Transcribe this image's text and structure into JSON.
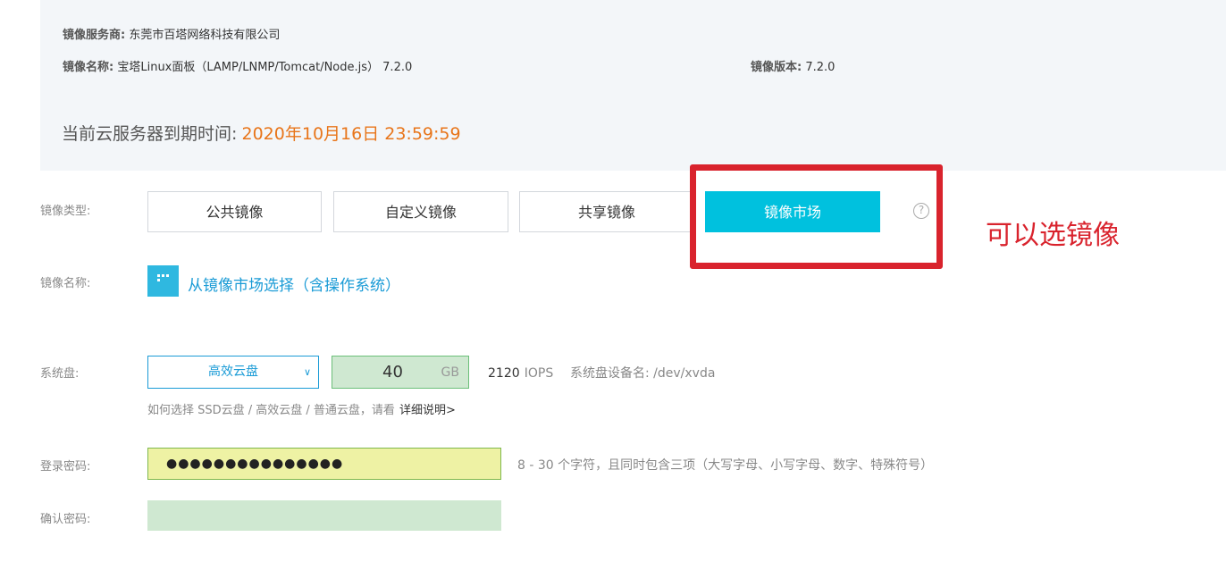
{
  "image_info": {
    "provider_label": "镜像服务商:",
    "provider_value": "东莞市百塔网络科技有限公司",
    "name_label": "镜像名称:",
    "name_value": "宝塔Linux面板（LAMP/LNMP/Tomcat/Node.js） 7.2.0",
    "version_label": "镜像版本:",
    "version_value": "7.2.0",
    "expire_label": "当前云服务器到期时间:",
    "expire_value": "2020年10月16日 23:59:59"
  },
  "image_type": {
    "label": "镜像类型:",
    "tabs": [
      "公共镜像",
      "自定义镜像",
      "共享镜像",
      "镜像市场"
    ],
    "active_tab": "镜像市场",
    "help_icon": "question-circle-icon"
  },
  "annotation": {
    "text": "可以选镜像",
    "color": "#d9232d"
  },
  "image_name": {
    "label": "镜像名称:",
    "link": "从镜像市场选择（含操作系统）",
    "icon": "grid-apps-icon"
  },
  "system_disk": {
    "label": "系统盘:",
    "type_selected": "高效云盘",
    "size": "40",
    "unit": "GB",
    "iops_value": "2120",
    "iops_unit": "IOPS",
    "device_label": "系统盘设备名:",
    "device_value": "/dev/xvda",
    "hint": "如何选择 SSD云盘 / 高效云盘 / 普通云盘，请看",
    "hint_link": "详细说明>"
  },
  "login": {
    "password_label": "登录密码:",
    "password_value": "●●●●●●●●●●●●●●●",
    "password_hint": "8 - 30 个字符，且同时包含三项（大写字母、小写字母、数字、特殊符号）",
    "confirm_label": "确认密码:",
    "confirm_value": ""
  },
  "colors": {
    "accent": "#00c1de",
    "link": "#1a9bd6",
    "expire": "#e8751a",
    "highlight": "#d9232d"
  }
}
